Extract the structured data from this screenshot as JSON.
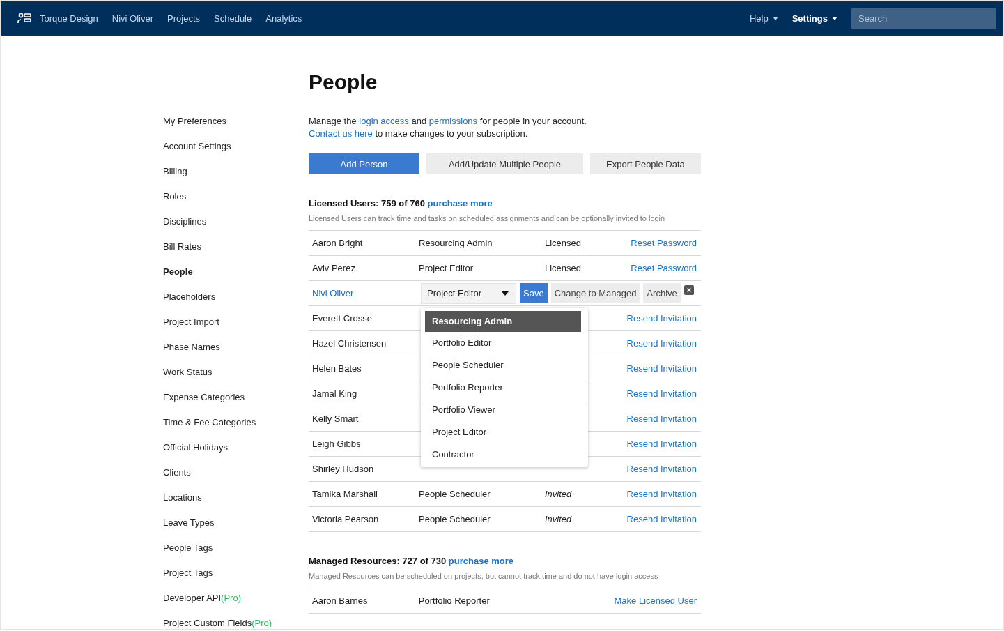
{
  "nav": {
    "links": [
      "Torque Design",
      "Nivi Oliver",
      "Projects",
      "Schedule",
      "Analytics"
    ],
    "menus": [
      {
        "label": "Help",
        "bold": false
      },
      {
        "label": "Settings",
        "bold": true
      }
    ],
    "search": {
      "placeholder": "Search"
    }
  },
  "sidebar": {
    "items": [
      {
        "label": "My Preferences",
        "selected": false
      },
      {
        "label": "Account Settings",
        "selected": false
      },
      {
        "label": "Billing",
        "selected": false
      },
      {
        "label": "Roles",
        "selected": false
      },
      {
        "label": "Disciplines",
        "selected": false
      },
      {
        "label": "Bill Rates",
        "selected": false
      },
      {
        "label": "People",
        "selected": true
      },
      {
        "label": "Placeholders",
        "selected": false
      },
      {
        "label": "Project Import",
        "selected": false
      },
      {
        "label": "Phase Names",
        "selected": false
      },
      {
        "label": "Work Status",
        "selected": false
      },
      {
        "label": "Expense Categories",
        "selected": false
      },
      {
        "label": "Time & Fee Categories",
        "selected": false
      },
      {
        "label": "Official Holidays",
        "selected": false
      },
      {
        "label": "Clients",
        "selected": false
      },
      {
        "label": "Locations",
        "selected": false
      },
      {
        "label": "Leave Types",
        "selected": false
      },
      {
        "label": "People Tags",
        "selected": false
      },
      {
        "label": "Project Tags",
        "selected": false
      },
      {
        "label": "Developer API",
        "selected": false,
        "badge": "(Pro)"
      },
      {
        "label": "Project Custom Fields",
        "selected": false,
        "badge": "(Pro)"
      }
    ]
  },
  "page": {
    "title": "People",
    "intro": [
      [
        {
          "text": "Manage the ",
          "kind": "text"
        },
        {
          "text": "login access",
          "kind": "link"
        },
        {
          "text": " and ",
          "kind": "text"
        },
        {
          "text": "permissions",
          "kind": "link"
        },
        {
          "text": " for people in your account.",
          "kind": "text"
        }
      ],
      [
        {
          "text": "Contact us here",
          "kind": "link"
        },
        {
          "text": " to make changes to your subscription.",
          "kind": "text"
        }
      ]
    ],
    "buttons": [
      {
        "label": "Add Person",
        "kind": "primary"
      },
      {
        "label": "Add/Update Multiple People",
        "kind": "secondary"
      },
      {
        "label": "Export People Data",
        "kind": "secondary"
      }
    ],
    "sections": [
      {
        "heading": "Licensed Users: 759 of 760",
        "link": "purchase more",
        "note": "Licensed Users can track time and tasks on scheduled assignments and can be optionally invited to login",
        "rows": [
          {
            "kind": "view",
            "name": "Aaron Bright",
            "role": "Resourcing Admin",
            "status": "Licensed",
            "italic": false,
            "action": "Reset Password"
          },
          {
            "kind": "view",
            "name": "Aviv Perez",
            "role": "Project Editor",
            "status": "Licensed",
            "italic": false,
            "action": "Reset Password"
          },
          {
            "kind": "edit",
            "name": "Nivi Oliver",
            "select": "Project Editor",
            "buttons": [
              {
                "label": "Save",
                "kind": "primary"
              },
              {
                "label": "Change to Managed",
                "kind": "secondary"
              },
              {
                "label": "Archive",
                "kind": "secondary"
              }
            ],
            "options": [
              {
                "label": "Resourcing Admin",
                "selected": true
              },
              {
                "label": "Portfolio Editor",
                "selected": false
              },
              {
                "label": "People Scheduler",
                "selected": false
              },
              {
                "label": "Portfolio Reporter",
                "selected": false
              },
              {
                "label": "Portfolio Viewer",
                "selected": false
              },
              {
                "label": "Project Editor",
                "selected": false
              },
              {
                "label": "Contractor",
                "selected": false
              }
            ]
          },
          {
            "kind": "view",
            "name": "Everett Crosse",
            "action": "Resend Invitation"
          },
          {
            "kind": "view",
            "name": "Hazel Christensen",
            "action": "Resend Invitation"
          },
          {
            "kind": "view",
            "name": "Helen Bates",
            "action": "Resend Invitation"
          },
          {
            "kind": "view",
            "name": "Jamal King",
            "action": "Resend Invitation"
          },
          {
            "kind": "view",
            "name": "Kelly Smart",
            "action": "Resend Invitation"
          },
          {
            "kind": "view",
            "name": "Leigh Gibbs",
            "action": "Resend Invitation"
          },
          {
            "kind": "view",
            "name": "Shirley Hudson",
            "action": "Resend Invitation"
          },
          {
            "kind": "view",
            "name": "Tamika Marshall",
            "role": "People Scheduler",
            "status": "Invited",
            "italic": true,
            "action": "Resend Invitation"
          },
          {
            "kind": "view",
            "name": "Victoria Pearson",
            "role": "People Scheduler",
            "status": "Invited",
            "italic": true,
            "action": "Resend Invitation"
          }
        ]
      },
      {
        "heading": "Managed Resources: 727 of 730",
        "link": "purchase more",
        "note": "Managed Resources can be scheduled on projects, but cannot track time and do not have login access",
        "rows": [
          {
            "kind": "view",
            "name": "Aaron Barnes",
            "role": "Portfolio Reporter",
            "action": "Make Licensed User"
          }
        ]
      }
    ]
  }
}
